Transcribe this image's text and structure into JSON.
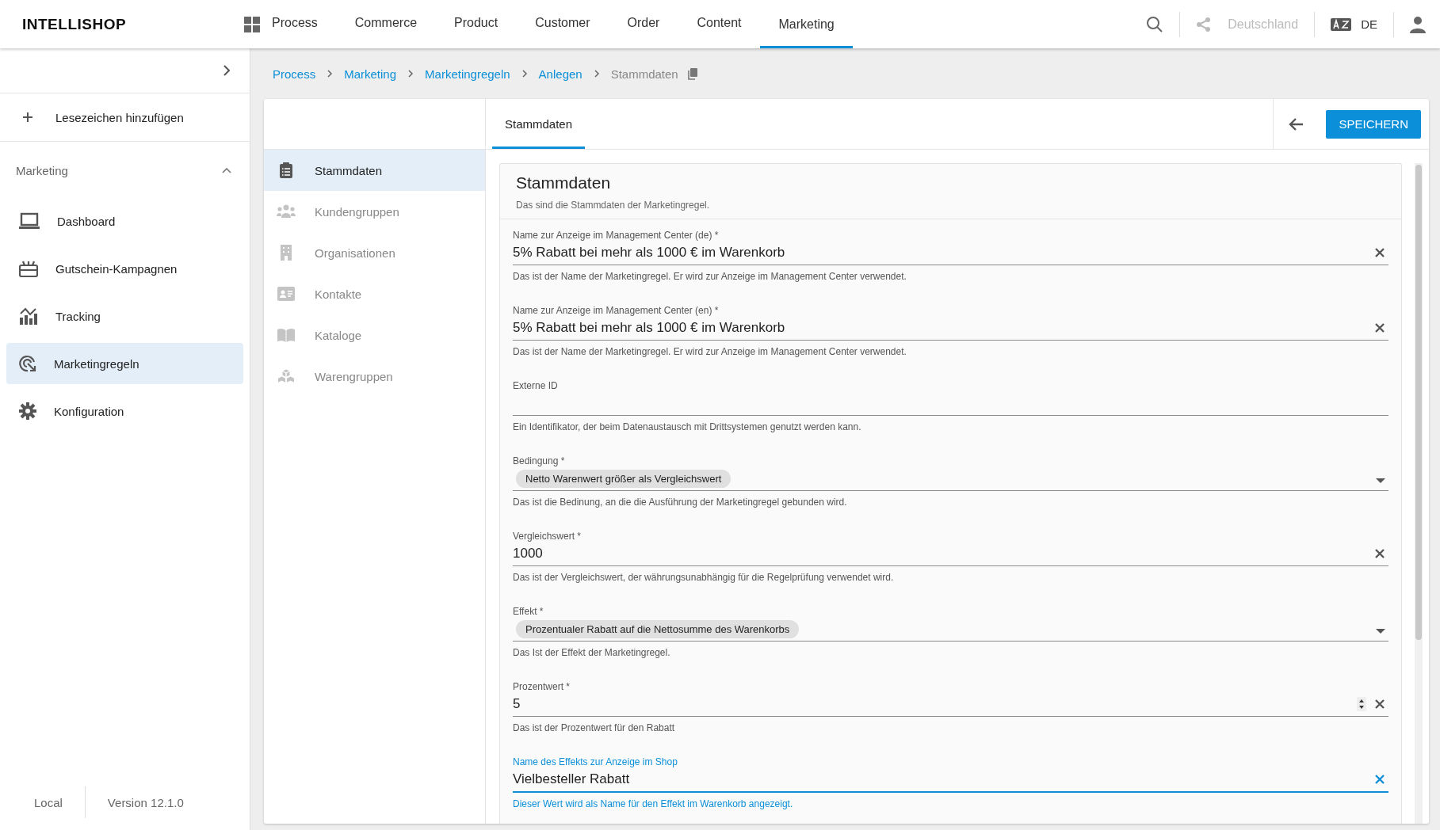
{
  "header": {
    "logo": "INTELLISHOP",
    "nav": [
      {
        "label": "Process",
        "selected": false
      },
      {
        "label": "Commerce",
        "selected": false
      },
      {
        "label": "Product",
        "selected": false
      },
      {
        "label": "Customer",
        "selected": false
      },
      {
        "label": "Order",
        "selected": false
      },
      {
        "label": "Content",
        "selected": false
      },
      {
        "label": "Marketing",
        "selected": true
      }
    ],
    "country": {
      "label": "Deutschland",
      "disabled": true
    },
    "language": "DE"
  },
  "sidebar": {
    "bookmark": "Lesezeichen hinzufügen",
    "section": {
      "title": "Marketing",
      "expanded": true
    },
    "items": [
      {
        "label": "Dashboard",
        "selected": false
      },
      {
        "label": "Gutschein-Kampagnen",
        "selected": false
      },
      {
        "label": "Tracking",
        "selected": false
      },
      {
        "label": "Marketingregeln",
        "selected": true
      },
      {
        "label": "Konfiguration",
        "selected": false
      }
    ],
    "footer": {
      "environment": "Local",
      "version": "Version 12.1.0"
    }
  },
  "breadcrumb": [
    {
      "label": "Process",
      "current": false
    },
    {
      "label": "Marketing",
      "current": false
    },
    {
      "label": "Marketingregeln",
      "current": false
    },
    {
      "label": "Anlegen",
      "current": false
    },
    {
      "label": "Stammdaten",
      "current": true
    }
  ],
  "tabs": [
    {
      "label": "Stammdaten",
      "selected": true
    }
  ],
  "save_button": "SPEICHERN",
  "subnav": [
    {
      "label": "Stammdaten",
      "selected": true
    },
    {
      "label": "Kundengruppen",
      "selected": false
    },
    {
      "label": "Organisationen",
      "selected": false
    },
    {
      "label": "Kontakte",
      "selected": false
    },
    {
      "label": "Kataloge",
      "selected": false
    },
    {
      "label": "Warengruppen",
      "selected": false
    }
  ],
  "form": {
    "title": "Stammdaten",
    "subtitle": "Das sind die Stammdaten der Marketingregel.",
    "fields": [
      {
        "kind": "text",
        "label": "Name zur Anzeige im Management Center (de) *",
        "value": "5% Rabatt bei mehr als 1000 € im Warenkorb",
        "hint": "Das ist der Name der Marketingregel. Er wird zur Anzeige im Management Center verwendet.",
        "focused": false
      },
      {
        "kind": "text",
        "label": "Name zur Anzeige im Management Center (en) *",
        "value": "5% Rabatt bei mehr als 1000 € im Warenkorb",
        "hint": "Das ist der Name der Marketingregel. Er wird zur Anzeige im Management Center verwendet.",
        "focused": false
      },
      {
        "kind": "empty",
        "label": "Externe ID",
        "hint": "Ein Identifikator, der beim Datenaustausch mit Drittsystemen genutzt werden kann.",
        "focused": false
      },
      {
        "kind": "select",
        "label": "Bedingung *",
        "value": "Netto Warenwert größer als Vergleichswert",
        "hint": "Das ist die Bedinung, an die die Ausführung der Marketingregel gebunden wird.",
        "focused": false
      },
      {
        "kind": "text",
        "label": "Vergleichswert *",
        "value": "1000",
        "hint": "Das ist der Vergleichswert, der währungsunabhängig für die Regelprüfung verwendet wird.",
        "focused": false
      },
      {
        "kind": "select",
        "label": "Effekt *",
        "value": "Prozentualer Rabatt auf die Nettosumme des Warenkorbs",
        "hint": "Das Ist der Effekt der Marketingregel.",
        "focused": false
      },
      {
        "kind": "number",
        "label": "Prozentwert *",
        "value": "5",
        "hint": "Das ist der Prozentwert für den Rabatt",
        "focused": false
      },
      {
        "kind": "text",
        "label": "Name des Effekts zur Anzeige im Shop",
        "value": "Vielbesteller Rabatt",
        "hint": "Dieser Wert wird als Name für den Effekt im Warenkorb angezeigt.",
        "focused": true
      }
    ]
  }
}
